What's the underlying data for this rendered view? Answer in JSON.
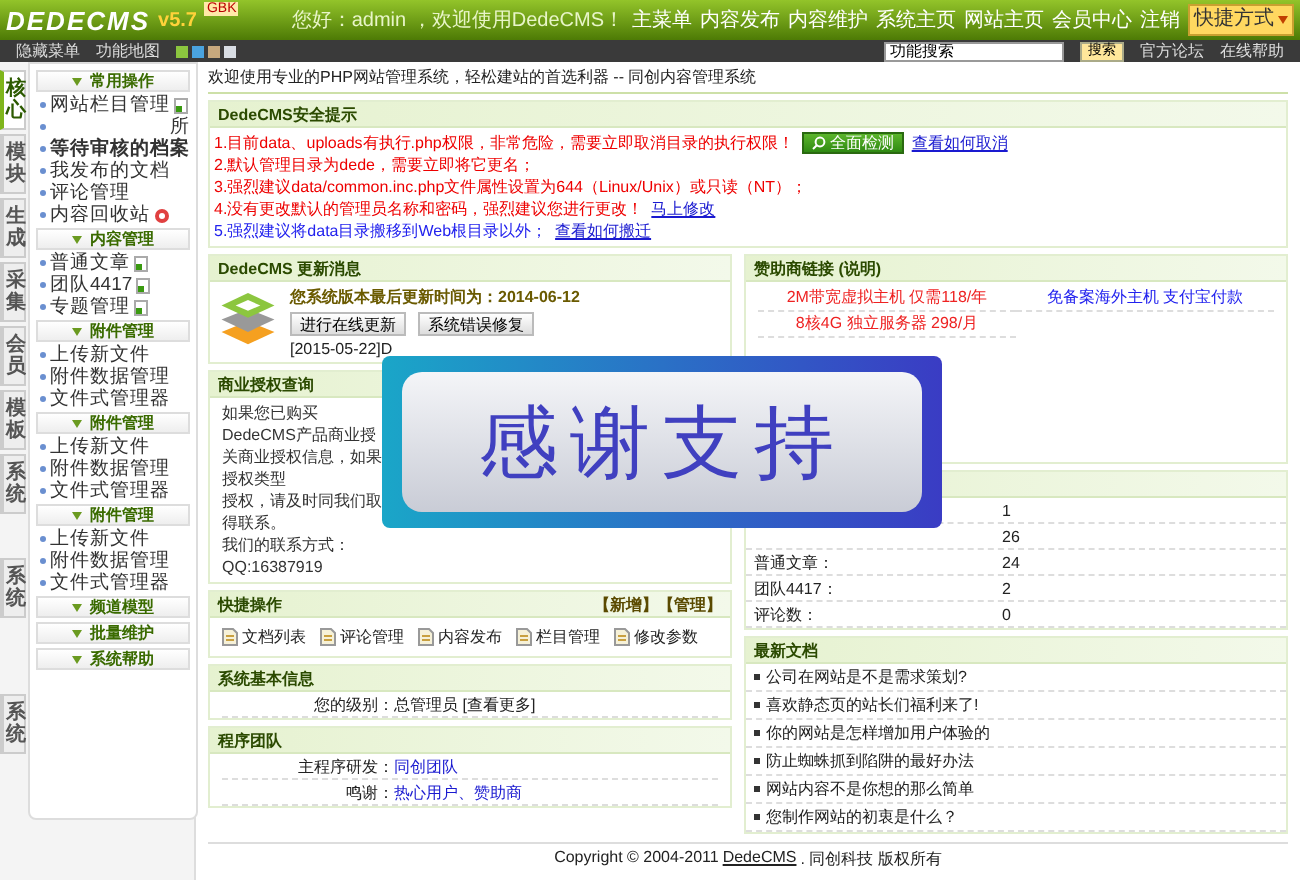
{
  "header": {
    "logo": "DEDECMS",
    "version": "v5.7",
    "edition": "GBK",
    "greeting": "您好：admin ，欢迎使用DedeCMS！",
    "nav": [
      "主菜单",
      "内容发布",
      "内容维护",
      "系统主页",
      "网站主页",
      "会员中心",
      "注销"
    ],
    "shortcut": "快捷方式"
  },
  "toolbar": {
    "hide_menu": "隐藏菜单",
    "feature_map": "功能地图",
    "skins": [
      {
        "color": "#8cc63f"
      },
      {
        "color": "#4aa3df"
      },
      {
        "color": "#c8a97e"
      },
      {
        "color": "#d8dde3"
      }
    ],
    "search": {
      "value": "功能搜索"
    },
    "search_button": "搜索",
    "links": [
      "官方论坛",
      "在线帮助"
    ]
  },
  "sidebar": {
    "tabs": [
      {
        "label": "核心",
        "selected": true
      },
      {
        "label": "模块",
        "selected": false
      },
      {
        "label": "生成",
        "selected": false
      },
      {
        "label": "采集",
        "selected": false
      },
      {
        "label": "会员",
        "selected": false
      },
      {
        "label": "模板",
        "selected": false
      },
      {
        "label": "系统",
        "selected": false
      },
      {
        "label": "系统",
        "selected": false
      },
      {
        "label": "系统",
        "selected": false
      }
    ],
    "sections": [
      {
        "title": "常用操作",
        "items": [
          {
            "label": "网站栏目管理",
            "kind": "add"
          },
          {
            "label": "所",
            "kind": "right"
          },
          {
            "label": "等待审核的档案",
            "kind": "bold"
          },
          {
            "label": "我发布的文档",
            "kind": "plain"
          },
          {
            "label": "评论管理",
            "kind": "plain"
          },
          {
            "label": "内容回收站",
            "kind": "recycle"
          }
        ]
      },
      {
        "title": "内容管理",
        "items": [
          {
            "label": "普通文章",
            "kind": "add"
          },
          {
            "label": "团队4417",
            "kind": "add"
          },
          {
            "label": "专题管理",
            "kind": "add"
          }
        ]
      },
      {
        "title": "附件管理",
        "items": [
          {
            "label": "上传新文件",
            "kind": "plain"
          },
          {
            "label": "附件数据管理",
            "kind": "plain"
          },
          {
            "label": "文件式管理器",
            "kind": "plain"
          }
        ]
      },
      {
        "title": "附件管理",
        "items": [
          {
            "label": "上传新文件",
            "kind": "plain"
          },
          {
            "label": "附件数据管理",
            "kind": "plain"
          },
          {
            "label": "文件式管理器",
            "kind": "plain"
          }
        ]
      },
      {
        "title": "附件管理",
        "items": [
          {
            "label": "上传新文件",
            "kind": "plain"
          },
          {
            "label": "附件数据管理",
            "kind": "plain"
          },
          {
            "label": "文件式管理器",
            "kind": "plain"
          }
        ]
      },
      {
        "title": "频道模型"
      },
      {
        "title": "批量维护"
      },
      {
        "title": "系统帮助"
      }
    ]
  },
  "welcome": "欢迎使用专业的PHP网站管理系统，轻松建站的首选利器 -- 同创内容管理系统",
  "security": {
    "title": "DedeCMS安全提示",
    "check_button": "全面检测",
    "lines": [
      {
        "text": "1.目前data、uploads有执行.php权限，非常危险，需要立即取消目录的执行权限！",
        "link": "查看如何取消",
        "button": true,
        "color": "#ee0000"
      },
      {
        "text": "2.默认管理目录为dede，需要立即将它更名；",
        "color": "#ee0000"
      },
      {
        "text": "3.强烈建议data/common.inc.php文件属性设置为644（Linux/Unix）或只读（NT）；",
        "color": "#ee0000"
      },
      {
        "text": "4.没有更改默认的管理员名称和密码，强烈建议您进行更改！",
        "link": "马上修改",
        "color": "#ee0000"
      },
      {
        "text": "5.强烈建议将data目录搬移到Web根目录以外；",
        "link": "查看如何搬迁",
        "color": "#2222ee"
      }
    ]
  },
  "update": {
    "title": "DedeCMS 更新消息",
    "version_text": "您系统版本最后更新时间为：2014-06-12",
    "buttons": [
      "进行在线更新",
      "系统错误修复"
    ],
    "news": "[2015-05-22]D"
  },
  "business": {
    "title": "商业授权查询",
    "lines": [
      "如果您已购买DedeCMS产品商业授",
      "关商业授权信息，如果授权类型",
      "授权，请及时同我们取得联系。",
      "我们的联系方式：QQ:16387919"
    ]
  },
  "quick": {
    "title": "快捷操作",
    "actions": [
      "【新增】",
      "【管理】"
    ],
    "items": [
      "文档列表",
      "评论管理",
      "内容发布",
      "栏目管理",
      "修改参数"
    ]
  },
  "sysinfo": {
    "title": "系统基本信息",
    "label": "您的级别：",
    "value": "总管理员 [查看更多]"
  },
  "team": {
    "title": "程序团队",
    "rows": [
      {
        "label": "主程序研发：",
        "value": "同创团队"
      },
      {
        "label": "鸣谢：",
        "value": "热心用户、赞助商"
      }
    ]
  },
  "sponsor": {
    "title": "赞助商链接",
    "note": "(说明)",
    "links": [
      {
        "text": "2M带宽虚拟主机 仅需118/年",
        "color": "#ee2222"
      },
      {
        "text": "免备案海外主机 支付宝付款",
        "color": "#2222ee"
      },
      {
        "text": "8核4G 独立服务器 298/月",
        "color": "#ee2222"
      }
    ]
  },
  "stats": {
    "rows": [
      {
        "value": "1"
      },
      {
        "value": "26"
      },
      {
        "label": "普通文章：",
        "value": "24"
      },
      {
        "label": "团队4417：",
        "value": "2"
      },
      {
        "label": "评论数：",
        "value": "0"
      }
    ]
  },
  "latest": {
    "title": "最新文档",
    "items": [
      "公司在网站是不是需求策划?",
      "喜欢静态页的站长们福利来了!",
      "你的网站是怎样增加用户体验的",
      "防止蜘蛛抓到陷阱的最好办法",
      "网站内容不是你想的那么简单",
      "您制作网站的初衷是什么？"
    ]
  },
  "overlay": {
    "text": "感谢支持"
  },
  "footer": {
    "text": "Copyright © 2004-2011",
    "link": "DedeCMS",
    "owner": ". 同创科技 版权所有"
  }
}
